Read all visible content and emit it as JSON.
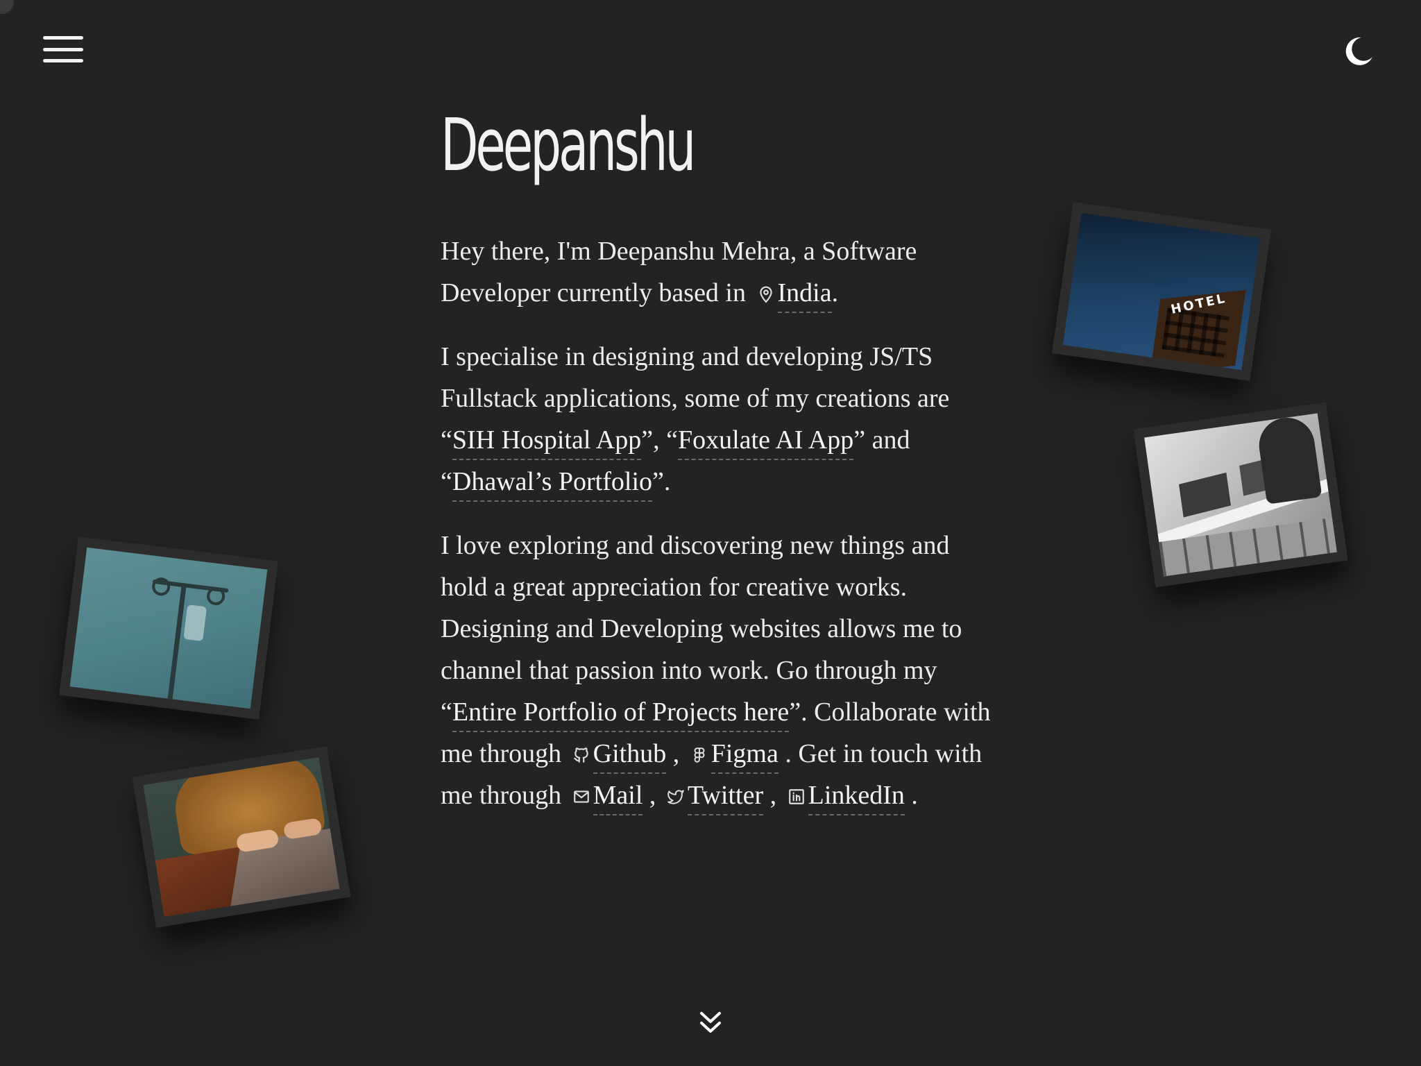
{
  "header": {
    "menu_icon": "hamburger-menu-icon",
    "theme_icon": "moon-icon"
  },
  "hero": {
    "name": "Deepanshu",
    "p1_text": "Hey there, I'm Deepanshu Mehra, a Software Developer currently based in ",
    "p1_location_icon": "map-pin-icon",
    "p1_location": "India",
    "p1_end": ".",
    "p2_text": "I specialise in designing and developing JS/TS Fullstack applications, some of my creations are “",
    "p2_link1": "SIH Hospital App",
    "p2_sep1": "”, “",
    "p2_link2": "Foxulate AI App",
    "p2_sep2": "” and “",
    "p2_link3": "Dhawal’s Portfolio",
    "p2_end": "”.",
    "p3_text": "I love exploring and discovering new things and hold a great appreciation for creative works. Designing and Developing websites allows me to channel that passion into work. Go through my “",
    "p3_link": "Entire Portfolio of Projects here",
    "p3_mid": "”. Collaborate with me through ",
    "github_label": "Github",
    "sep_comma": " , ",
    "figma_label": "Figma",
    "p3_mid2": " . Get in touch with me through ",
    "mail_label": "Mail",
    "twitter_label": "Twitter",
    "linkedin_label": "LinkedIn",
    "p3_end": " ."
  },
  "photos": [
    {
      "name": "hotel-photo",
      "text": "HOTEL"
    },
    {
      "name": "office-photo"
    },
    {
      "name": "iv-stand-photo"
    },
    {
      "name": "laptop-photo"
    }
  ],
  "footer": {
    "scroll_icon": "chevrons-down-icon"
  },
  "colors": {
    "background": "#232323",
    "text": "#ececec",
    "link_underline": "#6a6a6a"
  }
}
